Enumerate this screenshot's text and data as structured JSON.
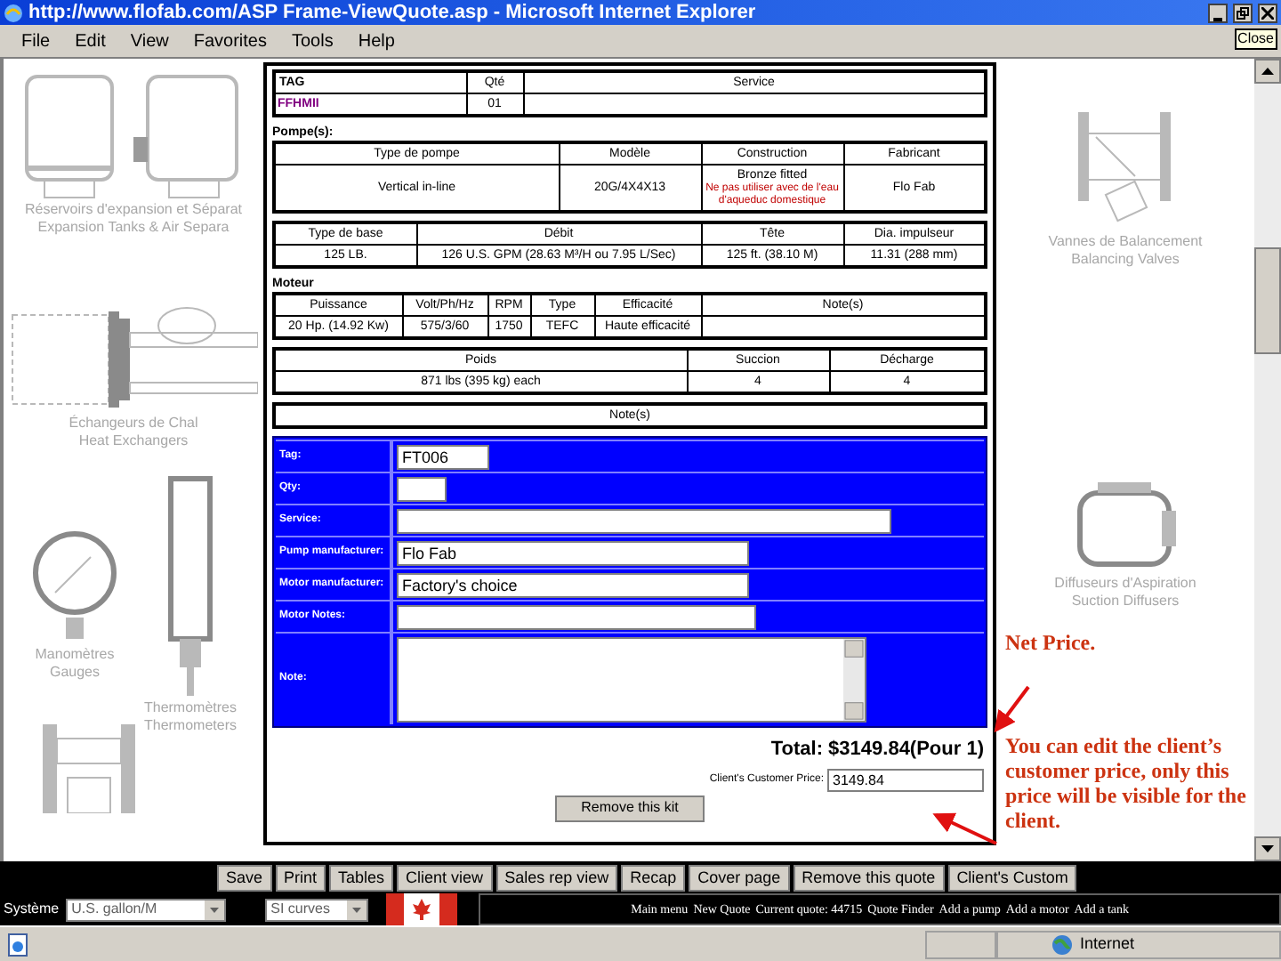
{
  "window": {
    "title": "http://www.flofab.com/ASP Frame-ViewQuote.asp - Microsoft Internet Explorer",
    "close_tooltip": "Close"
  },
  "menu": [
    "File",
    "Edit",
    "View",
    "Favorites",
    "Tools",
    "Help"
  ],
  "background": {
    "left": [
      {
        "kind": "tanks",
        "captions": [
          "Réservoirs d'expansion et Séparat",
          "Expansion Tanks & Air Separa"
        ]
      },
      {
        "kind": "exchanger",
        "captions": [
          "Échangeurs de Chal",
          "Heat Exchangers"
        ]
      },
      {
        "kind": "gauge",
        "captions": [
          "Manomètres",
          "Gauges"
        ]
      },
      {
        "kind": "thermometer",
        "captions": [
          "Thermomètres",
          "Thermometers"
        ]
      },
      {
        "kind": "pump"
      }
    ],
    "right": [
      {
        "kind": "valve",
        "captions": [
          "Vannes de Balancement",
          "Balancing Valves"
        ]
      },
      {
        "kind": "diffuser",
        "captions": [
          "Diffuseurs d'Aspiration",
          "Suction Diffusers"
        ]
      }
    ]
  },
  "quote": {
    "tables": [
      {
        "columns": [
          "TAG",
          "Qté",
          "Service"
        ],
        "rows": [
          [
            {
              "text": "FFHMII",
              "link": true
            },
            {
              "text": "01"
            }
          ]
        ]
      },
      {
        "label": "Pompe(s):",
        "columns": [
          "Type de pompe",
          "Modèle",
          "Construction",
          "Fabricant"
        ],
        "rows": [
          [
            {
              "text": "Vertical in-line"
            },
            {
              "text": "20G/4X4X13"
            },
            {
              "text": "Bronze fitted",
              "warning": "Ne pas utiliser avec de l'eau d'aqueduc domestique"
            },
            {
              "text": "Flo Fab"
            }
          ]
        ]
      },
      {
        "columns": [
          "Type de base",
          "Débit",
          "Tête",
          "Dia. impulseur"
        ],
        "rows": [
          [
            {
              "text": "125 LB."
            },
            {
              "text": "126 U.S. GPM (28.63 M³/H ou 7.95 L/Sec)"
            },
            {
              "text": "125 ft. (38.10 M)"
            },
            {
              "text": "11.31 (288 mm)"
            }
          ]
        ]
      },
      {
        "label": "Moteur",
        "columns": [
          "Puissance",
          "Volt/Ph/Hz",
          "RPM",
          "Type",
          "Efficacité",
          "Note(s)"
        ],
        "rows": [
          [
            {
              "text": "20 Hp. (14.92 Kw)"
            },
            {
              "text": "575/3/60"
            },
            {
              "text": "1750"
            },
            {
              "text": "TEFC"
            },
            {
              "text": "Haute efficacité"
            }
          ]
        ]
      },
      {
        "columns": [
          "Poids",
          "Succion",
          "Décharge"
        ],
        "rows": [
          [
            {
              "text": "871 lbs (395 kg) each"
            },
            {
              "text": "4"
            },
            {
              "text": "4"
            }
          ]
        ]
      },
      {
        "columns": [
          "Note(s)"
        ]
      }
    ],
    "form": [
      {
        "label": "Tag:",
        "kind": "input",
        "value": "FT006"
      },
      {
        "label": "Qty:",
        "kind": "input"
      },
      {
        "label": "Service:",
        "kind": "input"
      },
      {
        "label": "Pump manufacturer:",
        "kind": "input",
        "value": "Flo Fab"
      },
      {
        "label": "Motor manufacturer:",
        "kind": "input",
        "value": "Factory's choice"
      },
      {
        "label": "Motor Notes:",
        "kind": "input"
      },
      {
        "label": "Note:",
        "kind": "textarea"
      }
    ],
    "total": "Total: $3149.84(Pour 1)",
    "customer_price": {
      "label": "Client's Customer Price:",
      "value": "3149.84"
    },
    "remove_button": "Remove this kit"
  },
  "annotations": [
    {
      "text": "Net Price."
    },
    {
      "text": "You can edit the client’s customer price, only this price will be visible for the client."
    }
  ],
  "toolbar": {
    "buttons": [
      "Save",
      "Print",
      "Tables",
      "Client view",
      "Sales rep view",
      "Recap",
      "Cover page",
      "Remove this quote",
      "Client's Custom"
    ],
    "system_label": "Système",
    "unit_select": "U.S. gallon/M",
    "curve_select": "SI curves",
    "links": [
      "Main menu",
      "New Quote",
      "Current quote: 44715",
      "Quote Finder",
      "Add a pump",
      "Add a motor",
      "Add a tank"
    ]
  },
  "status_bar": {
    "zone": "Internet"
  }
}
